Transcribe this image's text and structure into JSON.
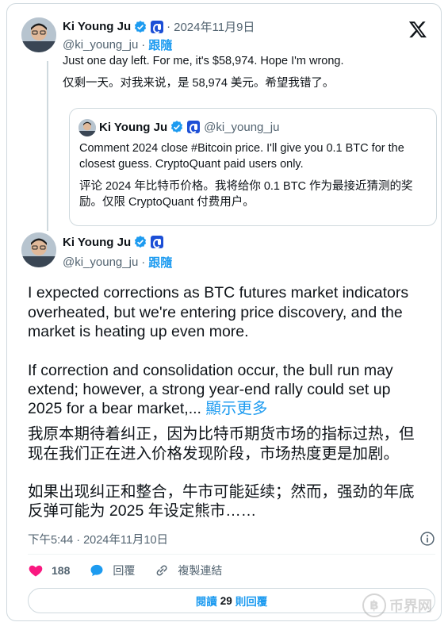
{
  "reply_tweet": {
    "author_name": "Ki Young Ju",
    "date": "2024年11月9日",
    "handle": "@ki_young_ju",
    "follow_label": "跟隨",
    "text_en": "Just one day left. For me, it's $58,974. Hope I'm wrong.",
    "text_zh": "仅剩一天。对我来说，是 58,974 美元。希望我错了。"
  },
  "quoted_tweet": {
    "author_name": "Ki Young Ju",
    "handle": "@ki_young_ju",
    "text_en_line1": "Comment 2024 close #Bitcoin price. I'll give you 0.1 BTC for the",
    "text_en_line2": "closest guess. CryptoQuant paid users only.",
    "text_zh_line1": "评论 2024 年比特币价格。我将给你 0.1 BTC 作为最接近猜测的奖",
    "text_zh_line2": "励。仅限 CryptoQuant 付费用户。"
  },
  "main_tweet": {
    "author_name": "Ki Young Ju",
    "handle": "@ki_young_ju",
    "follow_label": "跟隨",
    "p1_line1": "I expected corrections as BTC futures market indicators",
    "p1_line2": "overheated, but we're entering price discovery, and the",
    "p1_line3": "market is heating up even more.",
    "p2_line1": "If correction and consolidation occur, the bull run may",
    "p2_line2": "extend; however, a strong year-end rally could set up",
    "p2_line3": "2025 for a bear market,...",
    "show_more": "顯示更多",
    "zh_p1_line1": "我原本期待着纠正，因为比特币期货市场的指标过热，但",
    "zh_p1_line2": "现在我们正在进入价格发现阶段，市场热度更是加剧。",
    "zh_p2_line1": "如果出现纠正和整合，牛市可能延续；然而，强劲的年底",
    "zh_p2_line2": "反弹可能为 2025 年设定熊市……",
    "timestamp": "下午5:44 · 2024年11月10日"
  },
  "actions": {
    "like_count": "188",
    "reply_label": "回覆",
    "copy_link_label": "複製連結"
  },
  "read_replies": {
    "prefix": "閱讀",
    "count": "29",
    "suffix": "則回覆"
  },
  "watermark": {
    "coin_glyph": "฿",
    "text": "币界网"
  },
  "colors": {
    "accent": "#1d9bf0",
    "like": "#f91880",
    "muted": "#536471",
    "border": "#cfd9de"
  }
}
